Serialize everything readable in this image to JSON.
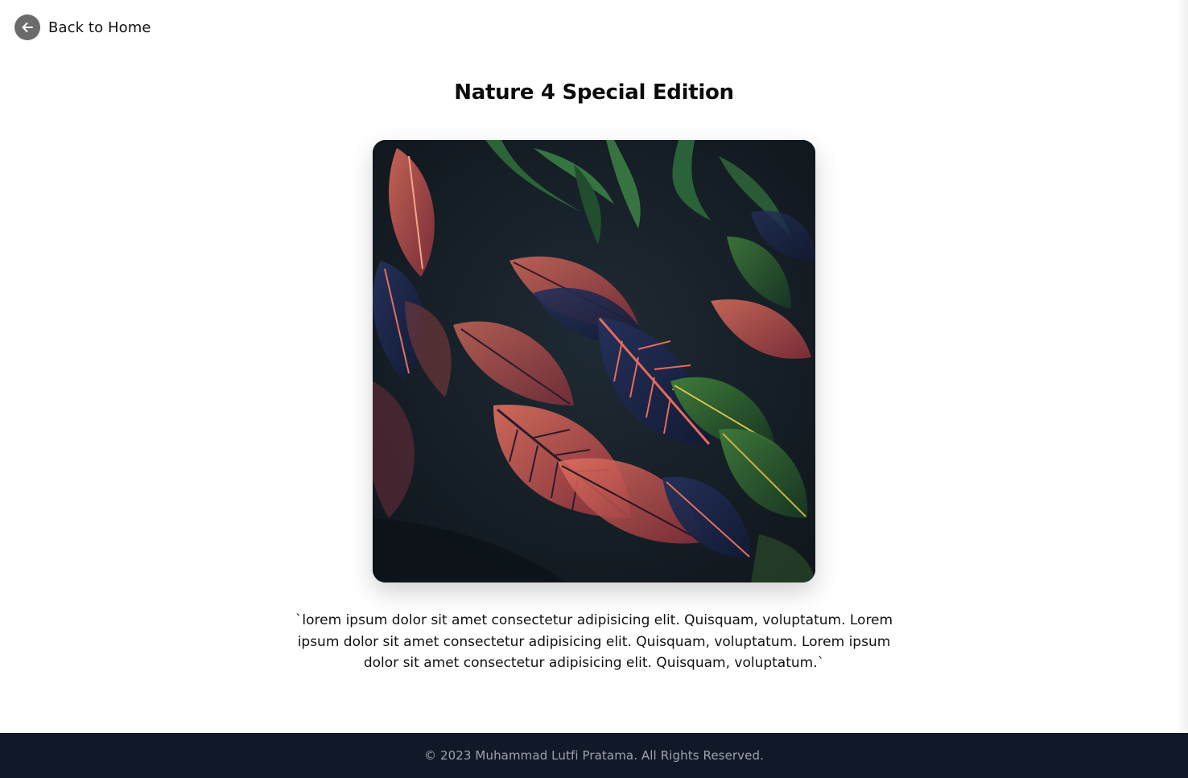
{
  "nav": {
    "back_label": "Back to Home",
    "back_icon": "arrow-left-icon"
  },
  "product": {
    "title": "Nature 4 Special Edition",
    "image_alt": "Nature 4 Special Edition",
    "description": "`lorem ipsum dolor sit amet consectetur adipisicing elit. Quisquam, voluptatum. Lorem ipsum dolor sit amet consectetur adipisicing elit. Quisquam, voluptatum. Lorem ipsum dolor sit amet consectetur adipisicing elit. Quisquam, voluptatum.`"
  },
  "footer": {
    "copyright": "© 2023 Muhammad Lutfi Pratama. All Rights Reserved."
  },
  "colors": {
    "footer_bg": "#111827",
    "footer_text": "#9ca3af",
    "back_icon_bg": "#6b6b6b"
  }
}
